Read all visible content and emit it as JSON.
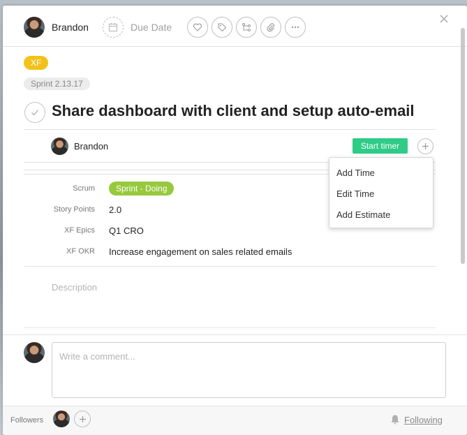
{
  "header": {
    "assignee_name": "Brandon",
    "due_date_label": "Due Date",
    "icons": [
      "heart-icon",
      "tag-icon",
      "subtask-icon",
      "attachment-icon",
      "more-icon"
    ],
    "close_icon": "close-icon"
  },
  "task": {
    "project_tag": "XF",
    "section_tag": "Sprint 2.13.17",
    "title": "Share dashboard with client and setup auto-email",
    "assignee_name": "Brandon",
    "start_timer_label": "Start timer"
  },
  "time_menu": {
    "items": [
      "Add Time",
      "Edit Time",
      "Add Estimate"
    ]
  },
  "fields": {
    "scrum": {
      "label": "Scrum",
      "value": "Sprint - Doing"
    },
    "story_points": {
      "label": "Story Points",
      "value": "2.0"
    },
    "xf_epics": {
      "label": "XF Epics",
      "value": "Q1 CRO"
    },
    "xf_okr": {
      "label": "XF OKR",
      "value": "Increase engagement on sales related emails"
    }
  },
  "description_placeholder": "Description",
  "comment": {
    "placeholder": "Write a comment..."
  },
  "footer": {
    "followers_label": "Followers",
    "following_label": "Following"
  },
  "colors": {
    "xf_tag": "#f2c21b",
    "start_timer": "#2ecc87",
    "scrum_pill": "#96c93d"
  }
}
